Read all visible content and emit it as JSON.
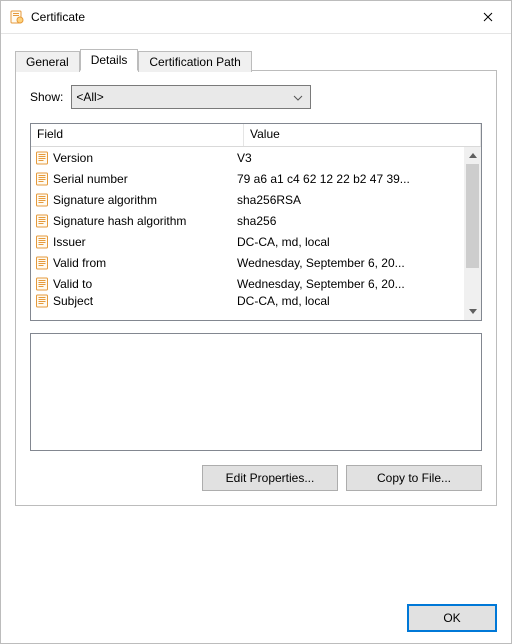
{
  "window": {
    "title": "Certificate"
  },
  "tabs": {
    "general": "General",
    "details": "Details",
    "certpath": "Certification Path"
  },
  "show": {
    "label": "Show:",
    "selected": "<All>"
  },
  "list": {
    "headers": {
      "field": "Field",
      "value": "Value"
    },
    "rows": [
      {
        "field": "Version",
        "value": "V3"
      },
      {
        "field": "Serial number",
        "value": "79 a6 a1 c4 62 12 22 b2 47 39..."
      },
      {
        "field": "Signature algorithm",
        "value": "sha256RSA"
      },
      {
        "field": "Signature hash algorithm",
        "value": "sha256"
      },
      {
        "field": "Issuer",
        "value": "DC-CA, md, local"
      },
      {
        "field": "Valid from",
        "value": "Wednesday, September 6, 20..."
      },
      {
        "field": "Valid to",
        "value": "Wednesday, September 6, 20..."
      },
      {
        "field": "Subject",
        "value": "DC-CA, md, local"
      }
    ]
  },
  "buttons": {
    "edit": "Edit Properties...",
    "copy": "Copy to File...",
    "ok": "OK"
  },
  "colors": {
    "iconOrange": "#e59a3c",
    "iconPaper": "#fffaf0",
    "accent": "#0078d7"
  }
}
